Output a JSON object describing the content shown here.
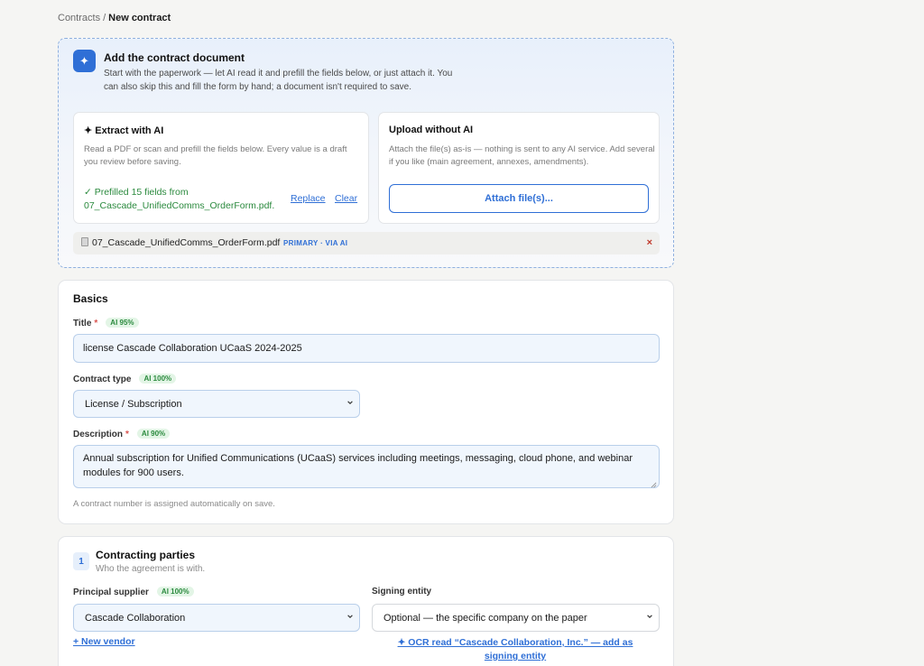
{
  "breadcrumb": {
    "parent": "Contracts",
    "separator": "/",
    "current": "New contract"
  },
  "upload": {
    "badge_icon": "✦",
    "title": "Add the contract document",
    "description": "Start with the paperwork — let AI read it and prefill the fields below, or just attach it. You can also skip this and fill the form by hand; a document isn't required to save.",
    "ai_option": {
      "title": "✦ Extract with AI",
      "description": "Read a PDF or scan and prefill the fields below. Every value is a draft you review before saving.",
      "status": "✓ Prefilled 15 fields from 07_Cascade_UnifiedComms_OrderForm.pdf.",
      "replace_label": "Replace",
      "clear_label": "Clear"
    },
    "plain_option": {
      "title": "Upload without AI",
      "description": "Attach the file(s) as-is — nothing is sent to any AI service. Add several if you like (main agreement, annexes, amendments).",
      "attach_label": "Attach file(s)..."
    },
    "file": {
      "name": "07_Cascade_UnifiedComms_OrderForm.pdf",
      "tag": "PRIMARY · VIA AI",
      "remove_icon": "×"
    }
  },
  "basics": {
    "title": "Basics",
    "title_field": {
      "label": "Title",
      "required": "*",
      "ai": "AI 95%",
      "value": "license Cascade Collaboration UCaaS 2024-2025"
    },
    "type_field": {
      "label": "Contract type",
      "ai": "AI 100%",
      "value": "License / Subscription"
    },
    "description_field": {
      "label": "Description",
      "required": "*",
      "ai": "AI 90%",
      "value": "Annual subscription for Unified Communications (UCaaS) services including meetings, messaging, cloud phone, and webinar modules for 900 users."
    },
    "hint": "A contract number is assigned automatically on save."
  },
  "parties": {
    "step": "1",
    "title": "Contracting parties",
    "subtitle": "Who the agreement is with.",
    "supplier": {
      "label": "Principal supplier",
      "ai": "AI 100%",
      "value": "Cascade Collaboration"
    },
    "signing": {
      "label": "Signing entity",
      "value": "Optional — the specific company on the paper"
    },
    "new_vendor_label": "+ New vendor",
    "ocr_label": "✦ OCR read “Cascade Collaboration, Inc.” — add as signing entity"
  },
  "colors": {
    "accent": "#2f6fd6",
    "success": "#2b8a3e",
    "danger": "#c0392b",
    "background": "#f5f5f3"
  }
}
